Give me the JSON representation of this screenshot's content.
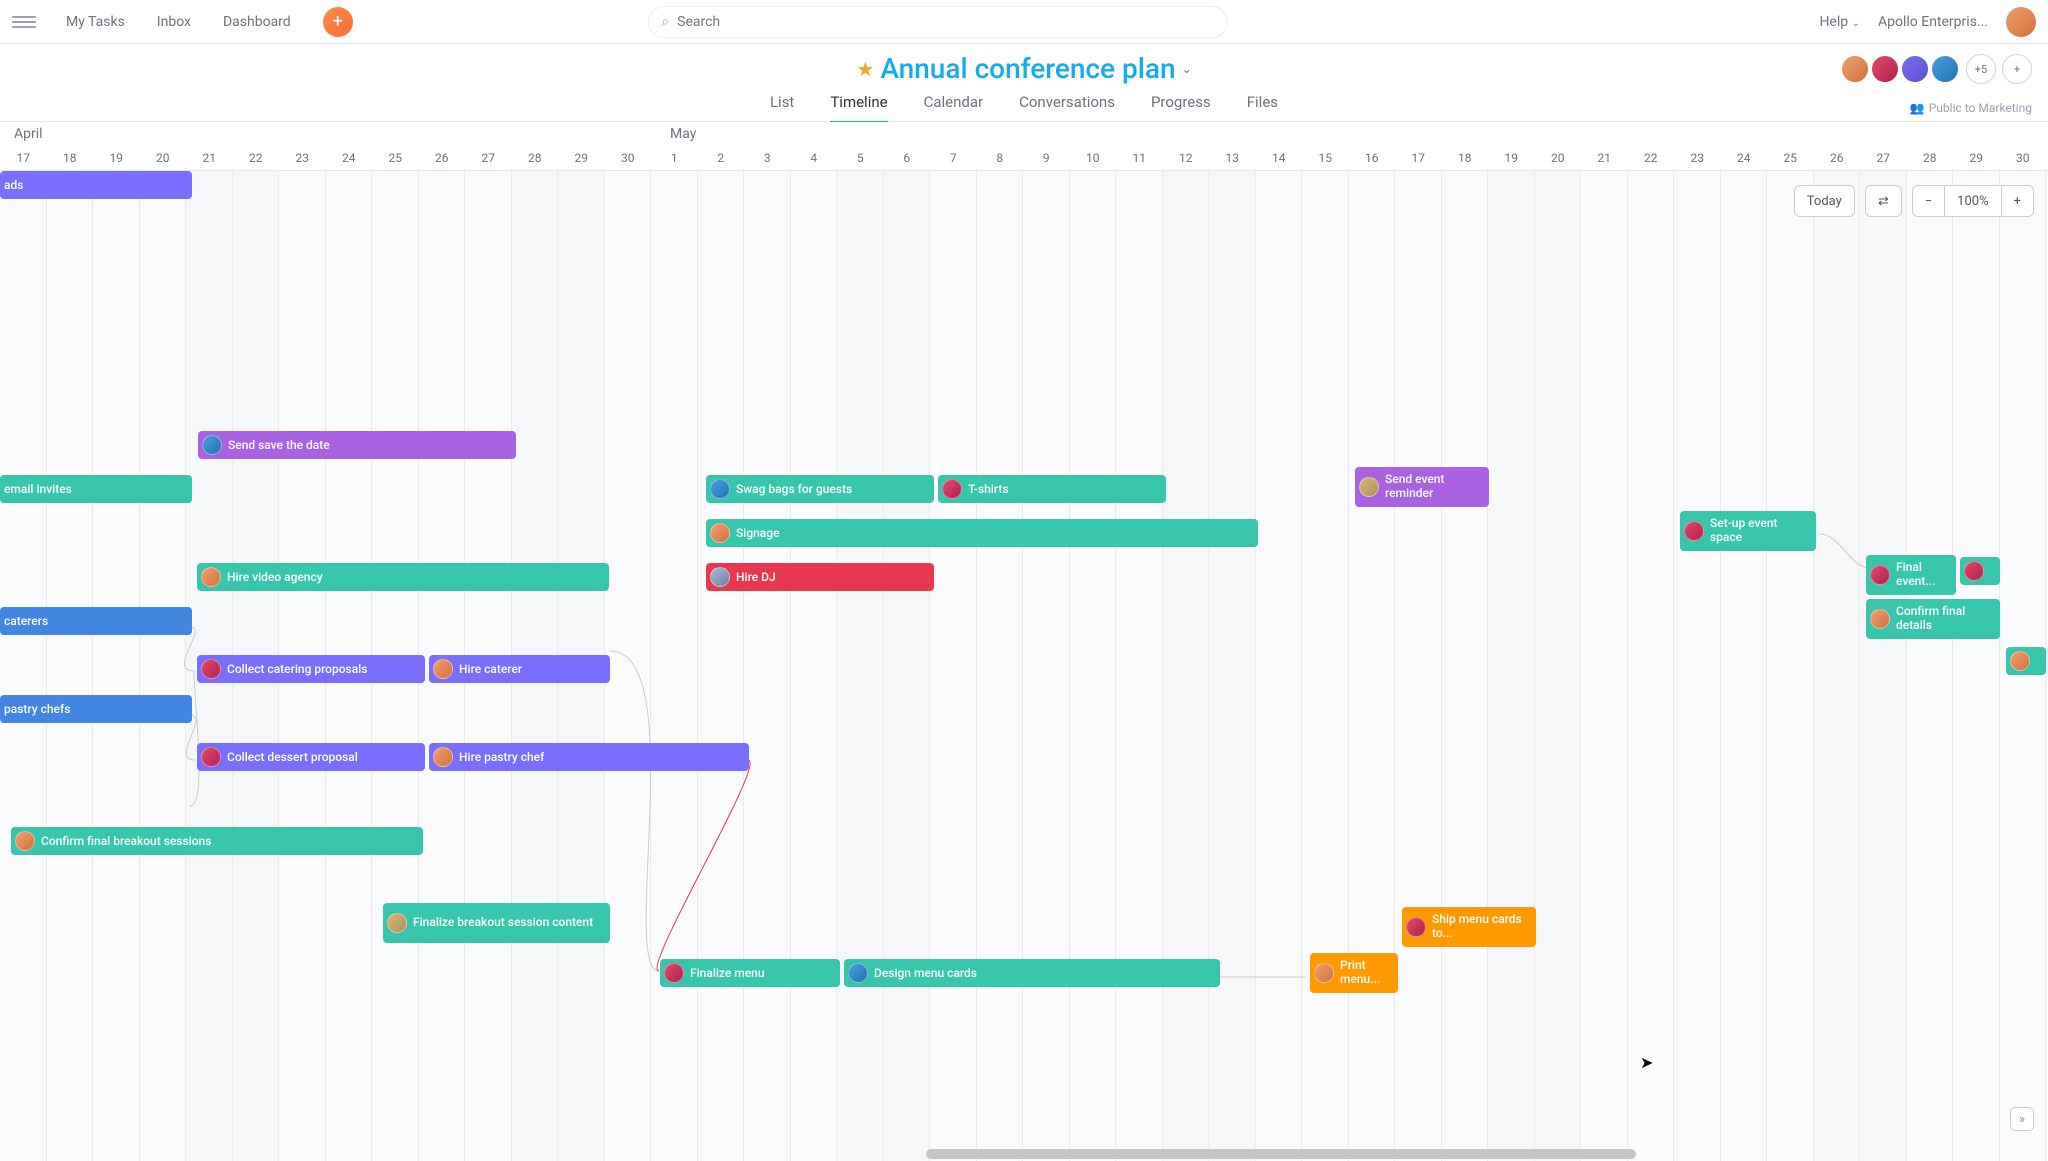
{
  "nav": {
    "my_tasks": "My Tasks",
    "inbox": "Inbox",
    "dashboard": "Dashboard",
    "search_placeholder": "Search",
    "help": "Help",
    "org": "Apollo Enterpris..."
  },
  "project": {
    "title": "Annual conference plan",
    "permission": "Public to Marketing",
    "extra_members": "+5",
    "tabs": {
      "list": "List",
      "timeline": "Timeline",
      "calendar": "Calendar",
      "conversations": "Conversations",
      "progress": "Progress",
      "files": "Files"
    }
  },
  "timeline": {
    "months": [
      "April",
      "May"
    ],
    "days": [
      17,
      18,
      19,
      20,
      21,
      22,
      23,
      24,
      25,
      26,
      27,
      28,
      29,
      30,
      1,
      2,
      3,
      4,
      5,
      6,
      7,
      8,
      9,
      10,
      11,
      12,
      13,
      14,
      15,
      16,
      17,
      18,
      19,
      20,
      21,
      22,
      23,
      24,
      25,
      26,
      27,
      28,
      29,
      30
    ],
    "controls": {
      "today": "Today",
      "zoom": "100%"
    }
  },
  "tasks": {
    "ads": "ads",
    "save_date": "Send save the date",
    "email_invites": "email invites",
    "swag": "Swag bags for guests",
    "tshirts": "T-shirts",
    "reminder": "Send event reminder",
    "signage": "Signage",
    "setup": "Set-up event space",
    "video_agency": "Hire video agency",
    "hire_dj": "Hire DJ",
    "final_event": "Final event...",
    "caterers": "caterers",
    "collect_catering": "Collect catering proposals",
    "hire_caterer": "Hire caterer",
    "confirm_final": "Confirm final details",
    "pastry_chefs": "pastry chefs",
    "collect_dessert": "Collect dessert proposal",
    "hire_pastry": "Hire pastry chef",
    "confirm_breakout": "Confirm final breakout sessions",
    "finalize_breakout": "Finalize breakout session content",
    "finalize_menu": "Finalize menu",
    "design_cards": "Design menu cards",
    "print_menu": "Print menu...",
    "ship_menu": "Ship menu cards to..."
  },
  "avatars": {
    "a1": "linear-gradient(135deg,#f0a068,#d07040)",
    "a2": "linear-gradient(135deg,#e24a68,#b02050)",
    "a3": "linear-gradient(135deg,#7a6ff0,#5a4fd0)",
    "a4": "linear-gradient(135deg,#4aa0e0,#2070b0)",
    "a5": "linear-gradient(135deg,#d8b878,#b09050)"
  }
}
